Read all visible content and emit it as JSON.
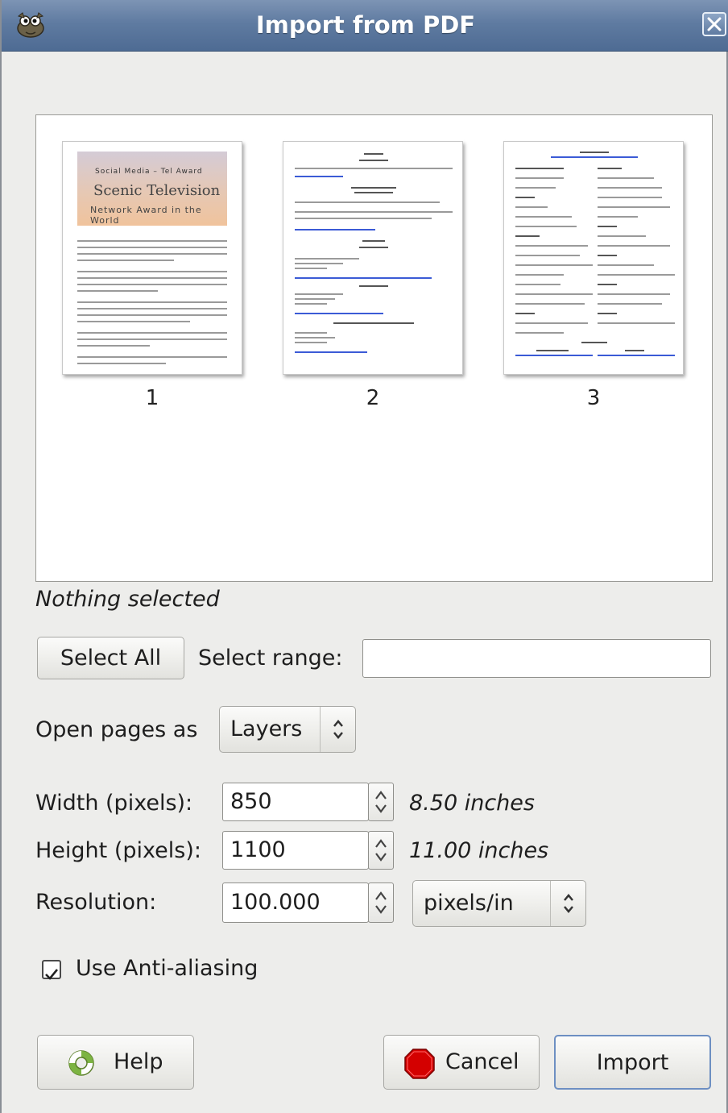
{
  "window": {
    "title": "Import from PDF",
    "titlebar_color": "#5f7ba1",
    "icons": {
      "app": "gimp-wilber-icon",
      "close": "close-x-icon"
    }
  },
  "preview": {
    "pages": [
      {
        "label": "1",
        "banner": {
          "line1": "Social Media – Tel Award",
          "line2": "Scenic Television",
          "line3": "Network Award in the World"
        }
      },
      {
        "label": "2"
      },
      {
        "label": "3"
      }
    ]
  },
  "status": "Nothing selected",
  "selection": {
    "select_all_label": "Select All",
    "select_range_label": "Select range:",
    "select_range_value": ""
  },
  "open_as": {
    "label": "Open pages as",
    "value": "Layers"
  },
  "dimensions": {
    "width_label": "Width (pixels):",
    "width_value": "850",
    "width_inches": "8.50 inches",
    "height_label": "Height (pixels):",
    "height_value": "1100",
    "height_inches": "11.00 inches",
    "resolution_label": "Resolution:",
    "resolution_value": "100.000",
    "resolution_unit": "pixels/in"
  },
  "antialias": {
    "label": "Use Anti-aliasing",
    "checked": true
  },
  "buttons": {
    "help": "Help",
    "help_icon": "lifebuoy-icon",
    "cancel": "Cancel",
    "cancel_icon": "stop-sign-icon",
    "import": "Import"
  }
}
